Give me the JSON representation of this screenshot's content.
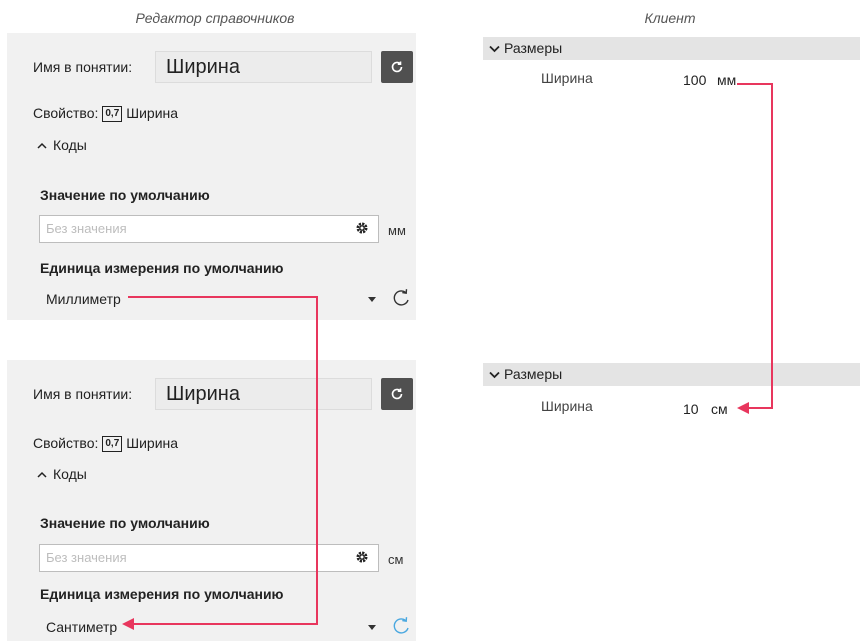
{
  "captions": {
    "editor": "Редактор справочников",
    "client": "Клиент"
  },
  "editor_top": {
    "name_label": "Имя в понятии:",
    "name_value": "Ширина",
    "property_label": "Свойство:",
    "property_badge": "0,7",
    "property_value": "Ширина",
    "codes_label": "Коды",
    "default_value_title": "Значение по умолчанию",
    "default_value_placeholder": "Без значения",
    "default_value_unit": "мм",
    "default_unit_title": "Единица измерения по умолчанию",
    "default_unit_value": "Миллиметр"
  },
  "editor_bottom": {
    "name_label": "Имя в понятии:",
    "name_value": "Ширина",
    "property_label": "Свойство:",
    "property_badge": "0,7",
    "property_value": "Ширина",
    "codes_label": "Коды",
    "default_value_title": "Значение по умолчанию",
    "default_value_placeholder": "Без значения",
    "default_value_unit": "см",
    "default_unit_title": "Единица измерения по умолчанию",
    "default_unit_value": "Сантиметр"
  },
  "client_top": {
    "group_label": "Размеры",
    "field_label": "Ширина",
    "value": "100",
    "unit": "мм"
  },
  "client_bottom": {
    "group_label": "Размеры",
    "field_label": "Ширина",
    "value": "10",
    "unit": "см"
  },
  "colors": {
    "arrow": "#e8365d",
    "reset_active": "#4aa8e0",
    "reset_default": "#333333",
    "button_dark": "#505050"
  }
}
